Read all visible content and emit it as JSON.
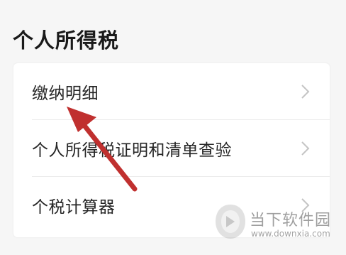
{
  "section": {
    "title": "个人所得税"
  },
  "menu": {
    "items": [
      {
        "label": "缴纳明细",
        "icon": "chevron-right-icon"
      },
      {
        "label": "个人所得税证明和清单查验",
        "icon": "chevron-right-icon"
      },
      {
        "label": "个税计算器",
        "icon": "chevron-right-icon"
      }
    ]
  },
  "annotation": {
    "color": "#c0302f"
  },
  "watermark": {
    "name": "当下软件园",
    "url": "www.downxia.com"
  }
}
